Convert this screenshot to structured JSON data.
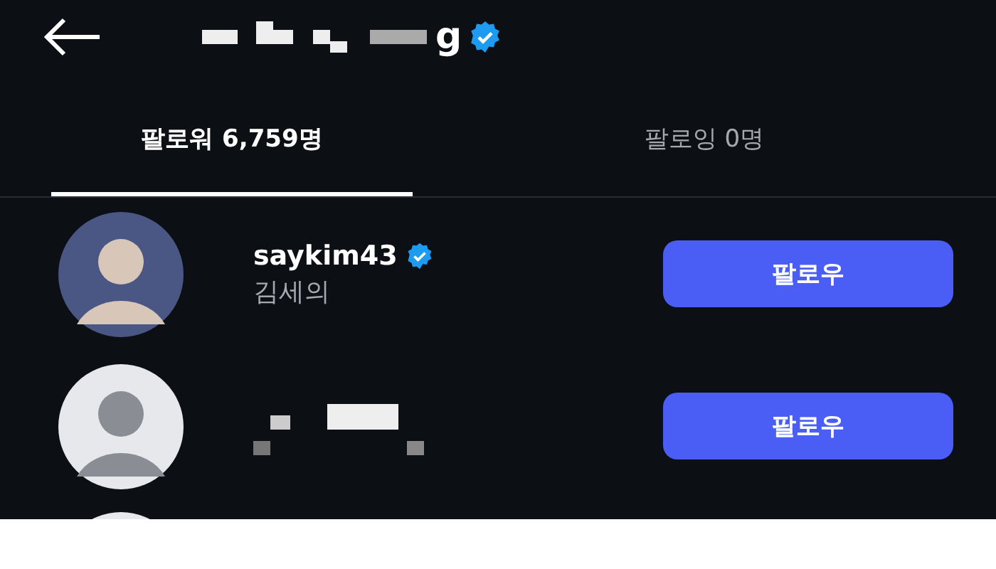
{
  "header": {
    "title": "g",
    "verified": true
  },
  "tabs": [
    {
      "label": "팔로워 6,759명",
      "selected": true
    },
    {
      "label": "팔로잉 0명",
      "selected": false
    }
  ],
  "rows": [
    {
      "kind": "user",
      "username": "saykim43",
      "verified": true,
      "name": "김세의",
      "button": "팔로우"
    },
    {
      "kind": "hidden",
      "button": "팔로우"
    },
    {
      "kind": "partial"
    }
  ]
}
